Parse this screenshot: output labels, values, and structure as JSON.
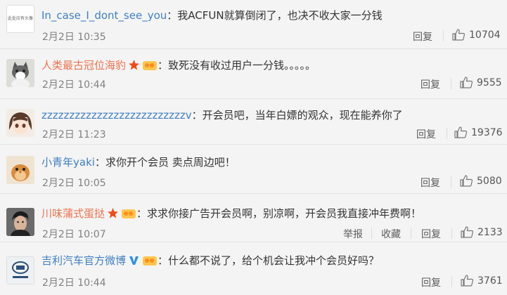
{
  "comments": [
    {
      "username": "In_case_I_dont_see_you",
      "text": "：我ACFUN就算倒闭了，也决不收大家一分钱",
      "date": "2月2日 10:35",
      "reply": "回复",
      "likes": "10704",
      "avatar_text": "此处应有头像"
    },
    {
      "username": "人类最古冠位海豹",
      "text": "：致死没有收过用户一分钱。。。。。",
      "date": "2月2日 10:44",
      "reply": "回复",
      "likes": "9555"
    },
    {
      "username": "zzzzzzzzzzzzzzzzzzzzzzzzzzv",
      "text": "：开会员吧，当年白嫖的观众，现在能养你了",
      "date": "2月2日 11:23",
      "reply": "回复",
      "likes": "19376"
    },
    {
      "username": "小青年yaki",
      "text": "：求你开个会员 卖点周边吧！",
      "date": "2月2日 10:05",
      "reply": "回复",
      "likes": "5080"
    },
    {
      "username": "川味蒲式蛋挞",
      "text": "：求求你接广告开会员啊，别凉啊，开会员我直接冲年费啊！",
      "date": "2月2日 10:07",
      "report": "举报",
      "favorite": "收藏",
      "reply": "回复",
      "likes": "2133"
    },
    {
      "username": "吉利汽车官方微博",
      "text": "：什么都不说了，给个机会让我冲个会员好吗？",
      "date": "2月2日 10:44",
      "reply": "回复",
      "likes": "3761"
    }
  ],
  "colors": {
    "username": "#eb7350",
    "username_verified": "#3f7fc1",
    "date": "#808080",
    "background": "#f4f4f4"
  }
}
